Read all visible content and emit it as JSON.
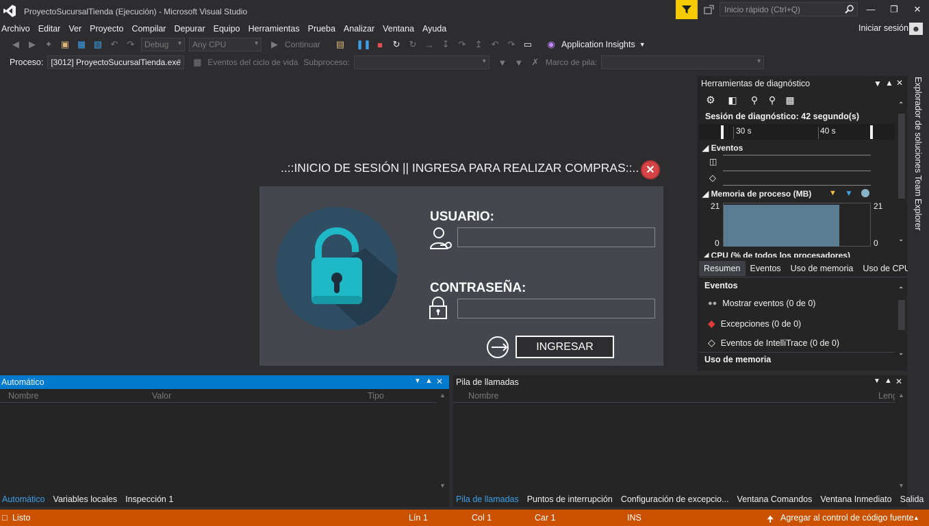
{
  "window": {
    "title": "ProyectoSucursalTienda (Ejecución) - Microsoft Visual Studio",
    "quick_launch_placeholder": "Inicio rápido (Ctrl+Q)",
    "sign_in": "Iniciar sesión"
  },
  "menu": [
    "Archivo",
    "Editar",
    "Ver",
    "Proyecto",
    "Compilar",
    "Depurar",
    "Equipo",
    "Herramientas",
    "Prueba",
    "Analizar",
    "Ventana",
    "Ayuda"
  ],
  "toolbar": {
    "config": "Debug",
    "platform": "Any CPU",
    "continue": "Continuar",
    "app_insights": "Application Insights"
  },
  "procbar": {
    "process_label": "Proceso:",
    "process_value": "[3012] ProyectoSucursalTienda.exe",
    "lifecycle": "Eventos del ciclo de vida",
    "thread_label": "Subproceso:",
    "frame_label": "Marco de pila:"
  },
  "dialog": {
    "title": "..::INICIO DE SESIÓN || INGRESA PARA REALIZAR COMPRAS::..",
    "user_label": "USUARIO:",
    "user_value": "",
    "password_label": "CONTRASEÑA:",
    "password_value": "",
    "login_button": "INGRESAR",
    "colors": {
      "lock_body": "#1fb8c7",
      "lock_circle": "#2f4e63",
      "close": "#d64545"
    }
  },
  "diagnostics": {
    "title": "Herramientas de diagnóstico",
    "session": "Sesión de diagnóstico: 42 segundo(s)",
    "timeline_ticks": [
      "30 s",
      "40 s"
    ],
    "events_section": "Eventos",
    "memory_section": "Memoria de proceso (MB)",
    "memory_max": "21",
    "memory_min": "0",
    "cpu_section": "CPU (% de todos los procesadores)",
    "tabs": [
      "Resumen",
      "Eventos",
      "Uso de memoria",
      "Uso de CPU"
    ],
    "events_heading": "Eventos",
    "event_rows": [
      {
        "icon": "show-events-icon",
        "text": "Mostrar eventos (0 de 0)"
      },
      {
        "icon": "exception-diamond-icon",
        "text": "Excepciones (0 de 0)"
      },
      {
        "icon": "intellitrace-diamond-icon",
        "text": "Eventos de IntelliTrace (0 de 0)"
      }
    ],
    "memory_heading": "Uso de memoria"
  },
  "rail": [
    "Explorador de soluciones",
    "Team Explorer"
  ],
  "auto_panel": {
    "title": "Automático",
    "columns": [
      "Nombre",
      "Valor",
      "Tipo"
    ],
    "tabs": [
      "Automático",
      "Variables locales",
      "Inspección 1"
    ]
  },
  "stack_panel": {
    "title": "Pila de llamadas",
    "columns": [
      "Nombre",
      "Leng"
    ],
    "tabs": [
      "Pila de llamadas",
      "Puntos de interrupción",
      "Configuración de excepcio...",
      "Ventana Comandos",
      "Ventana Inmediato",
      "Salida"
    ]
  },
  "status": {
    "ready": "Listo",
    "line": "Lín 1",
    "col": "Col 1",
    "car": "Car 1",
    "ins": "INS",
    "source_control": "Agregar al control de código fuente"
  }
}
